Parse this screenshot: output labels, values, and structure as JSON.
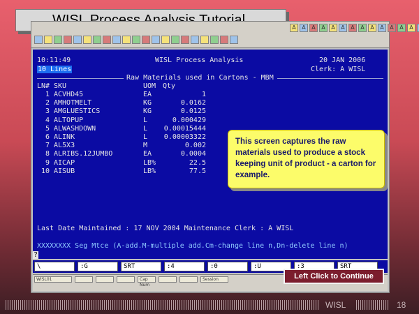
{
  "slide": {
    "title": "WISL Process Analysis Tutorial",
    "footer_brand": "WISL",
    "page_number": "18",
    "continue_label": "Left Click to Continue"
  },
  "toolbar": {
    "row1_icons": [
      "A",
      "A",
      "A",
      "A",
      "A",
      "A",
      "A",
      "A",
      "A",
      "A",
      "A",
      "A",
      "A",
      "A",
      "A"
    ],
    "row2_icons": [
      "",
      "",
      "",
      "",
      "",
      "",
      "",
      "",
      "",
      "",
      "",
      "",
      "",
      "",
      "",
      "",
      "",
      "",
      "",
      "",
      ""
    ]
  },
  "terminal": {
    "time": "10:11:49",
    "app_title": "WISL Process Analysis",
    "date": "20 JAN 2006",
    "lines_label": "10 Lines",
    "clerk": "Clerk: A WISL",
    "section_title": "Raw Materials used in Cartons - MBM",
    "columns": {
      "ln": "LN#",
      "sku": "SKU",
      "uom": "UOM",
      "qty": "Qty"
    },
    "rows": [
      {
        "ln": "1",
        "sku": "ACVHD45",
        "uom": "EA",
        "qty": "1"
      },
      {
        "ln": "2",
        "sku": "AMHOTMELT",
        "uom": "KG",
        "qty": "0.0162"
      },
      {
        "ln": "3",
        "sku": "AMGLUESTICS",
        "uom": "KG",
        "qty": "0.0125"
      },
      {
        "ln": "4",
        "sku": "ALTOPUP",
        "uom": "L",
        "qty": "0.000429"
      },
      {
        "ln": "5",
        "sku": "ALWASHDOWN",
        "uom": "L",
        "qty": "0.00015444"
      },
      {
        "ln": "6",
        "sku": "ALINK",
        "uom": "L",
        "qty": "0.00003322"
      },
      {
        "ln": "7",
        "sku": "AL5X3",
        "uom": "M",
        "qty": "0.002"
      },
      {
        "ln": "8",
        "sku": "ALRIBS.12JUMBO",
        "uom": "EA",
        "qty": "0.0004"
      },
      {
        "ln": "9",
        "sku": "AICAP",
        "uom": "LB%",
        "qty": "22.5"
      },
      {
        "ln": "10",
        "sku": "AISUB",
        "uom": "LB%",
        "qty": "77.5"
      }
    ],
    "maintenance": "Last Date Maintained : 17 NOV 2004 Maintenance Clerk : A WISL",
    "command_help": "XXXXXXXX Seg Mtce (A-add.M-multiple add.Cm-change line n,Dn-delete line n)",
    "prompt": "?"
  },
  "fkeys": [
    "\\",
    ":G",
    "SRT",
    ":4",
    ":0",
    ":U",
    ":3",
    "SRT"
  ],
  "status_cells": [
    "WISL01",
    "",
    "",
    "",
    "Cap Num",
    "",
    "",
    "Session"
  ],
  "callout": {
    "text": "This screen captures the raw materials used to produce a stock keeping unit of product - a carton for example."
  }
}
